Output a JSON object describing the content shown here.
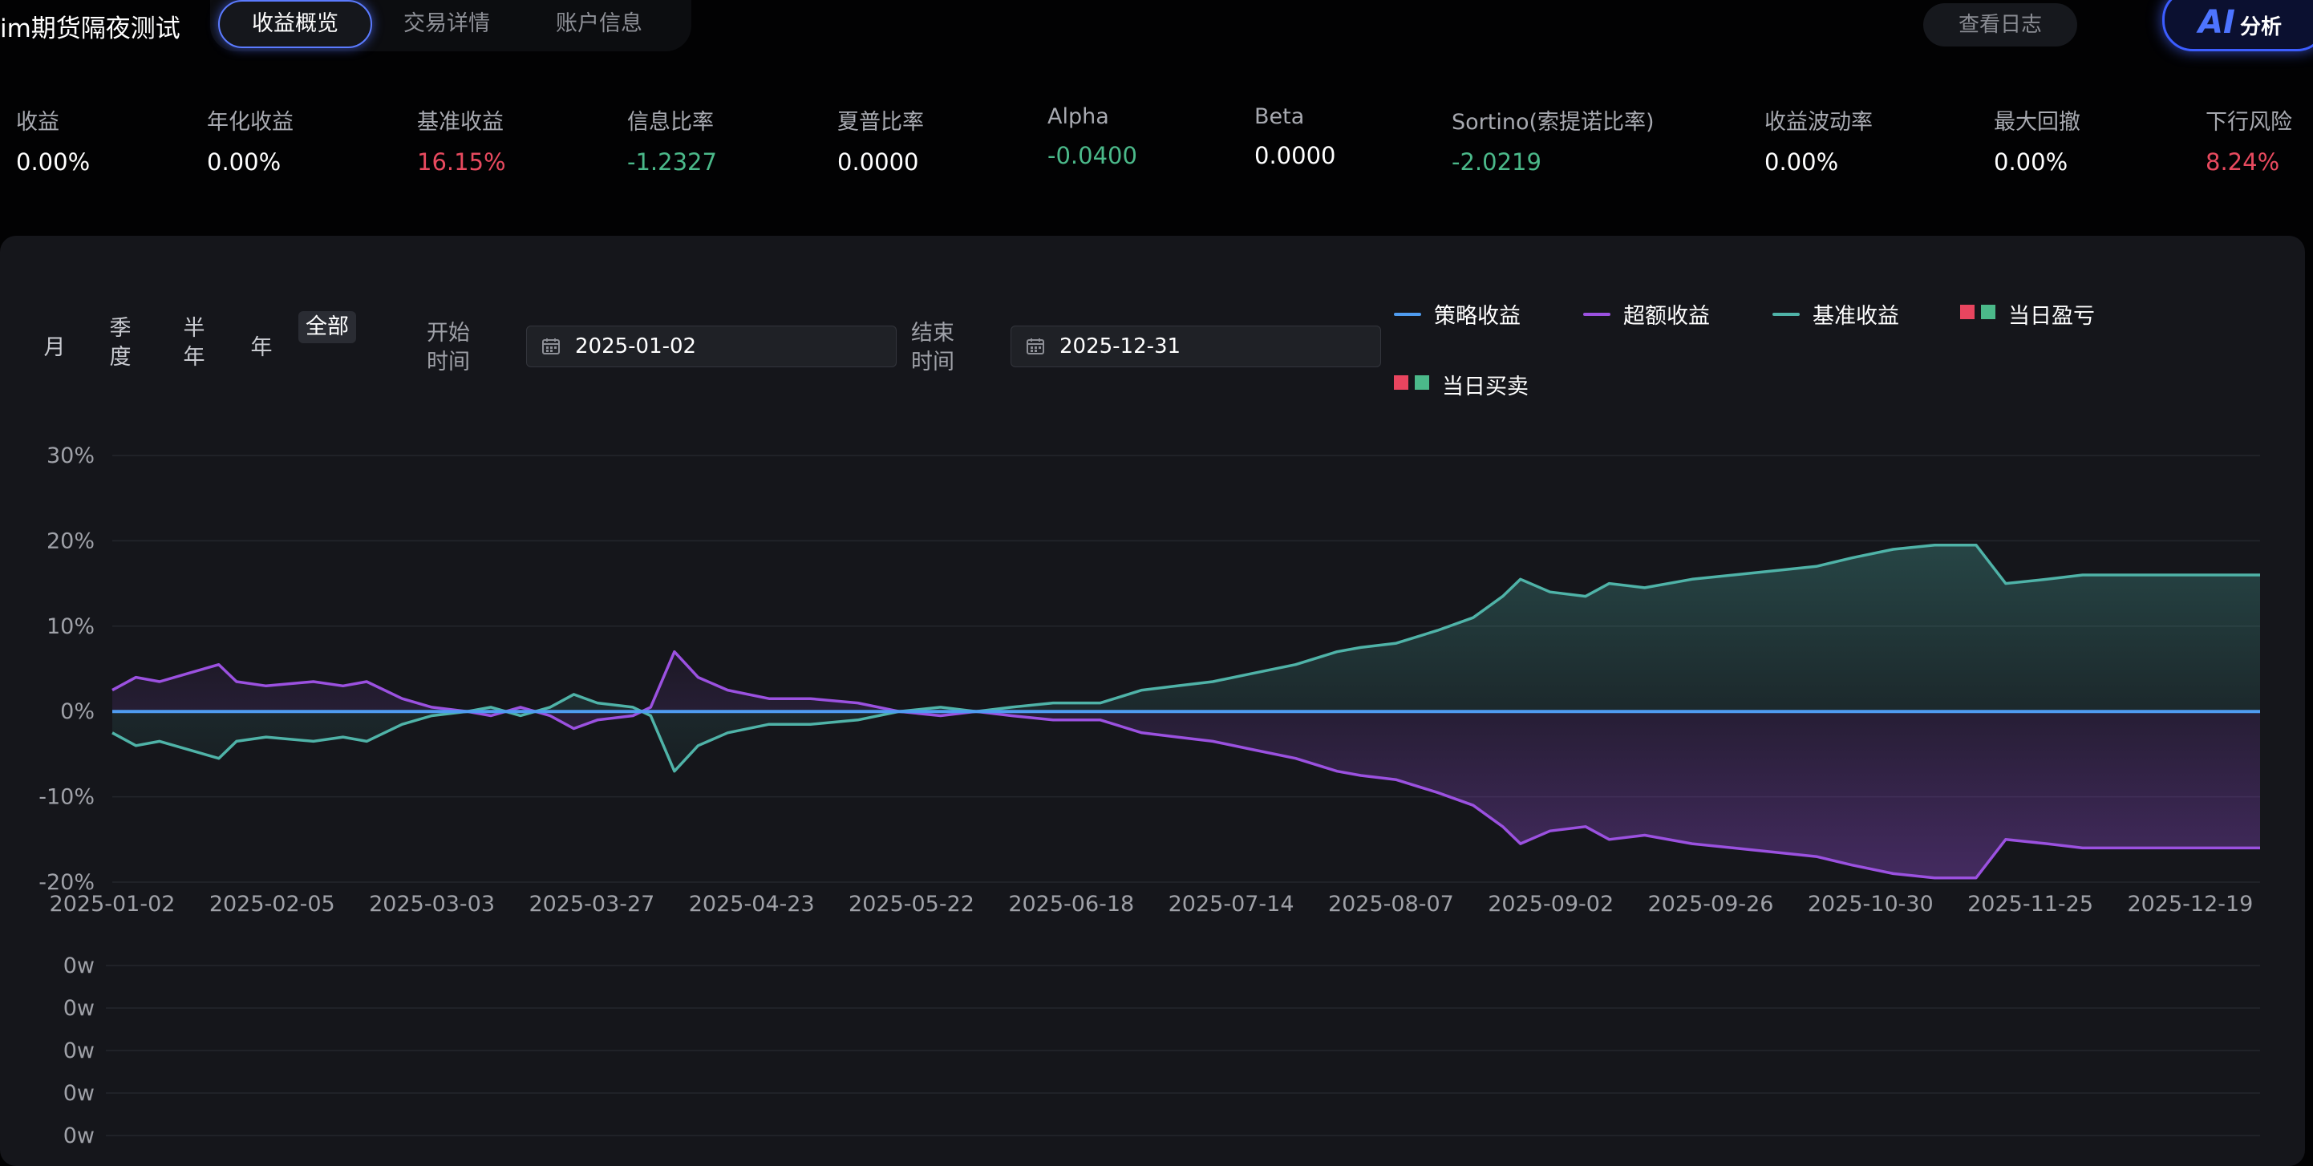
{
  "app": {
    "title": "im期货隔夜测试"
  },
  "tabs": [
    {
      "label": "收益概览",
      "active": true
    },
    {
      "label": "交易详情",
      "active": false
    },
    {
      "label": "账户信息",
      "active": false
    }
  ],
  "actions": {
    "log_label": "查看日志",
    "ai_icon": "AI",
    "ai_label": "分析"
  },
  "metrics": [
    {
      "label": "收益",
      "value": "0.00%",
      "tone": "neutral"
    },
    {
      "label": "年化收益",
      "value": "0.00%",
      "tone": "neutral"
    },
    {
      "label": "基准收益",
      "value": "16.15%",
      "tone": "red"
    },
    {
      "label": "信息比率",
      "value": "-1.2327",
      "tone": "green"
    },
    {
      "label": "夏普比率",
      "value": "0.0000",
      "tone": "neutral"
    },
    {
      "label": "Alpha",
      "value": "-0.0400",
      "tone": "green"
    },
    {
      "label": "Beta",
      "value": "0.0000",
      "tone": "neutral"
    },
    {
      "label": "Sortino(索提诺比率)",
      "value": "-2.0219",
      "tone": "green"
    },
    {
      "label": "收益波动率",
      "value": "0.00%",
      "tone": "neutral"
    },
    {
      "label": "最大回撤",
      "value": "0.00%",
      "tone": "neutral"
    },
    {
      "label": "下行风险",
      "value": "8.24%",
      "tone": "red"
    }
  ],
  "periods": [
    {
      "label": "月",
      "active": false
    },
    {
      "label": "季度",
      "active": false
    },
    {
      "label": "半年",
      "active": false
    },
    {
      "label": "年",
      "active": false
    },
    {
      "label": "全部",
      "active": true
    }
  ],
  "date_range": {
    "start_label": "开始时间",
    "start_value": "2025-01-02",
    "end_label": "结束时间",
    "end_value": "2025-12-31"
  },
  "legend": [
    {
      "label": "策略收益",
      "kind": "line",
      "color": "#4f9cf0"
    },
    {
      "label": "超额收益",
      "kind": "line",
      "color": "#9b51e0"
    },
    {
      "label": "基准收益",
      "kind": "line",
      "color": "#4fb3a8"
    },
    {
      "label": "当日盈亏",
      "kind": "squares",
      "colors": [
        "#e8455f",
        "#4bb98a"
      ]
    },
    {
      "label": "当日买卖",
      "kind": "squares",
      "colors": [
        "#e8455f",
        "#4bb98a"
      ]
    }
  ],
  "icons": {
    "calendar": "calendar-icon"
  },
  "colors": {
    "strategy": "#4f9cf0",
    "excess": "#9b51e0",
    "benchmark": "#4fb3a8",
    "loss": "#e8455f",
    "gain": "#4bb98a",
    "accent": "#3c5dff"
  },
  "chart_data": [
    {
      "type": "line",
      "y_tick_labels": [
        "30%",
        "20%",
        "10%",
        "0%",
        "-10%",
        "-20%"
      ],
      "ylim": [
        -20,
        30
      ],
      "x_tick_labels": [
        "2025-01-02",
        "2025-02-05",
        "2025-03-03",
        "2025-03-27",
        "2025-04-23",
        "2025-05-22",
        "2025-06-18",
        "2025-07-14",
        "2025-08-07",
        "2025-09-02",
        "2025-09-26",
        "2025-10-30",
        "2025-11-25",
        "2025-12-19"
      ],
      "xlim": [
        "2025-01-02",
        "2025-12-31"
      ],
      "grid": true,
      "series": [
        {
          "name": "策略收益",
          "points": [
            [
              "2025-01-02",
              0
            ],
            [
              "2025-12-31",
              0
            ]
          ]
        },
        {
          "name": "基准收益",
          "points": [
            [
              "2025-01-02",
              -2.5
            ],
            [
              "2025-01-06",
              -4
            ],
            [
              "2025-01-10",
              -3.5
            ],
            [
              "2025-01-15",
              -4.5
            ],
            [
              "2025-01-20",
              -5.5
            ],
            [
              "2025-01-23",
              -3.5
            ],
            [
              "2025-01-28",
              -3
            ],
            [
              "2025-02-05",
              -3.5
            ],
            [
              "2025-02-10",
              -3
            ],
            [
              "2025-02-14",
              -3.5
            ],
            [
              "2025-02-20",
              -1.5
            ],
            [
              "2025-02-25",
              -0.5
            ],
            [
              "2025-03-03",
              0
            ],
            [
              "2025-03-07",
              0.5
            ],
            [
              "2025-03-12",
              -0.5
            ],
            [
              "2025-03-17",
              0.5
            ],
            [
              "2025-03-21",
              2
            ],
            [
              "2025-03-25",
              1
            ],
            [
              "2025-03-31",
              0.5
            ],
            [
              "2025-04-03",
              -0.5
            ],
            [
              "2025-04-07",
              -7
            ],
            [
              "2025-04-11",
              -4
            ],
            [
              "2025-04-16",
              -2.5
            ],
            [
              "2025-04-23",
              -1.5
            ],
            [
              "2025-04-30",
              -1.5
            ],
            [
              "2025-05-08",
              -1
            ],
            [
              "2025-05-15",
              0
            ],
            [
              "2025-05-22",
              0.5
            ],
            [
              "2025-05-28",
              0
            ],
            [
              "2025-06-03",
              0.5
            ],
            [
              "2025-06-10",
              1
            ],
            [
              "2025-06-18",
              1
            ],
            [
              "2025-06-25",
              2.5
            ],
            [
              "2025-07-01",
              3
            ],
            [
              "2025-07-07",
              3.5
            ],
            [
              "2025-07-14",
              4.5
            ],
            [
              "2025-07-21",
              5.5
            ],
            [
              "2025-07-28",
              7
            ],
            [
              "2025-08-01",
              7.5
            ],
            [
              "2025-08-07",
              8
            ],
            [
              "2025-08-14",
              9.5
            ],
            [
              "2025-08-20",
              11
            ],
            [
              "2025-08-25",
              13.5
            ],
            [
              "2025-08-28",
              15.5
            ],
            [
              "2025-09-02",
              14
            ],
            [
              "2025-09-08",
              13.5
            ],
            [
              "2025-09-12",
              15
            ],
            [
              "2025-09-18",
              14.5
            ],
            [
              "2025-09-26",
              15.5
            ],
            [
              "2025-10-03",
              16
            ],
            [
              "2025-10-10",
              16.5
            ],
            [
              "2025-10-17",
              17
            ],
            [
              "2025-10-23",
              18
            ],
            [
              "2025-10-30",
              19
            ],
            [
              "2025-11-06",
              19.5
            ],
            [
              "2025-11-13",
              19.5
            ],
            [
              "2025-11-18",
              15
            ],
            [
              "2025-11-25",
              15.5
            ],
            [
              "2025-12-01",
              16
            ],
            [
              "2025-12-31",
              16
            ]
          ]
        },
        {
          "name": "超额收益",
          "points": [
            [
              "2025-01-02",
              2.5
            ],
            [
              "2025-01-06",
              4
            ],
            [
              "2025-01-10",
              3.5
            ],
            [
              "2025-01-15",
              4.5
            ],
            [
              "2025-01-20",
              5.5
            ],
            [
              "2025-01-23",
              3.5
            ],
            [
              "2025-01-28",
              3
            ],
            [
              "2025-02-05",
              3.5
            ],
            [
              "2025-02-10",
              3
            ],
            [
              "2025-02-14",
              3.5
            ],
            [
              "2025-02-20",
              1.5
            ],
            [
              "2025-02-25",
              0.5
            ],
            [
              "2025-03-03",
              0
            ],
            [
              "2025-03-07",
              -0.5
            ],
            [
              "2025-03-12",
              0.5
            ],
            [
              "2025-03-17",
              -0.5
            ],
            [
              "2025-03-21",
              -2
            ],
            [
              "2025-03-25",
              -1
            ],
            [
              "2025-03-31",
              -0.5
            ],
            [
              "2025-04-03",
              0.5
            ],
            [
              "2025-04-07",
              7
            ],
            [
              "2025-04-11",
              4
            ],
            [
              "2025-04-16",
              2.5
            ],
            [
              "2025-04-23",
              1.5
            ],
            [
              "2025-04-30",
              1.5
            ],
            [
              "2025-05-08",
              1
            ],
            [
              "2025-05-15",
              0
            ],
            [
              "2025-05-22",
              -0.5
            ],
            [
              "2025-05-28",
              0
            ],
            [
              "2025-06-03",
              -0.5
            ],
            [
              "2025-06-10",
              -1
            ],
            [
              "2025-06-18",
              -1
            ],
            [
              "2025-06-25",
              -2.5
            ],
            [
              "2025-07-01",
              -3
            ],
            [
              "2025-07-07",
              -3.5
            ],
            [
              "2025-07-14",
              -4.5
            ],
            [
              "2025-07-21",
              -5.5
            ],
            [
              "2025-07-28",
              -7
            ],
            [
              "2025-08-01",
              -7.5
            ],
            [
              "2025-08-07",
              -8
            ],
            [
              "2025-08-14",
              -9.5
            ],
            [
              "2025-08-20",
              -11
            ],
            [
              "2025-08-25",
              -13.5
            ],
            [
              "2025-08-28",
              -15.5
            ],
            [
              "2025-09-02",
              -14
            ],
            [
              "2025-09-08",
              -13.5
            ],
            [
              "2025-09-12",
              -15
            ],
            [
              "2025-09-18",
              -14.5
            ],
            [
              "2025-09-26",
              -15.5
            ],
            [
              "2025-10-03",
              -16
            ],
            [
              "2025-10-10",
              -16.5
            ],
            [
              "2025-10-17",
              -17
            ],
            [
              "2025-10-23",
              -18
            ],
            [
              "2025-10-30",
              -19
            ],
            [
              "2025-11-06",
              -19.5
            ],
            [
              "2025-11-13",
              -19.5
            ],
            [
              "2025-11-18",
              -15
            ],
            [
              "2025-11-25",
              -15.5
            ],
            [
              "2025-12-01",
              -16
            ],
            [
              "2025-12-31",
              -16
            ]
          ]
        }
      ]
    },
    {
      "type": "bar",
      "y_tick_labels": [
        "0w",
        "0w",
        "0w",
        "0w",
        "0w"
      ],
      "grid": true,
      "series": []
    }
  ]
}
